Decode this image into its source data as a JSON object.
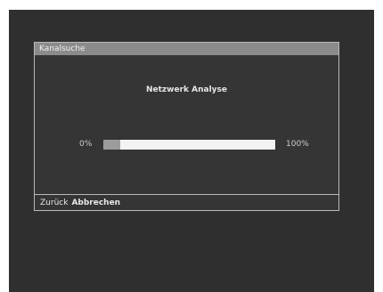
{
  "dialog": {
    "title": "Kanalsuche",
    "heading": "Netzwerk Analyse",
    "progress": {
      "start_label": "0%",
      "end_label": "100%",
      "fraction": 0.1
    },
    "footer": {
      "back_label": "Zurück",
      "cancel_label": "Abbrechen"
    }
  },
  "colors": {
    "screen_background": "#2f2f2f",
    "dialog_background": "#353535",
    "title_bar": "#8b8b8b",
    "progress_track": "#f3f3f3",
    "progress_fill": "#9c9c9c"
  }
}
